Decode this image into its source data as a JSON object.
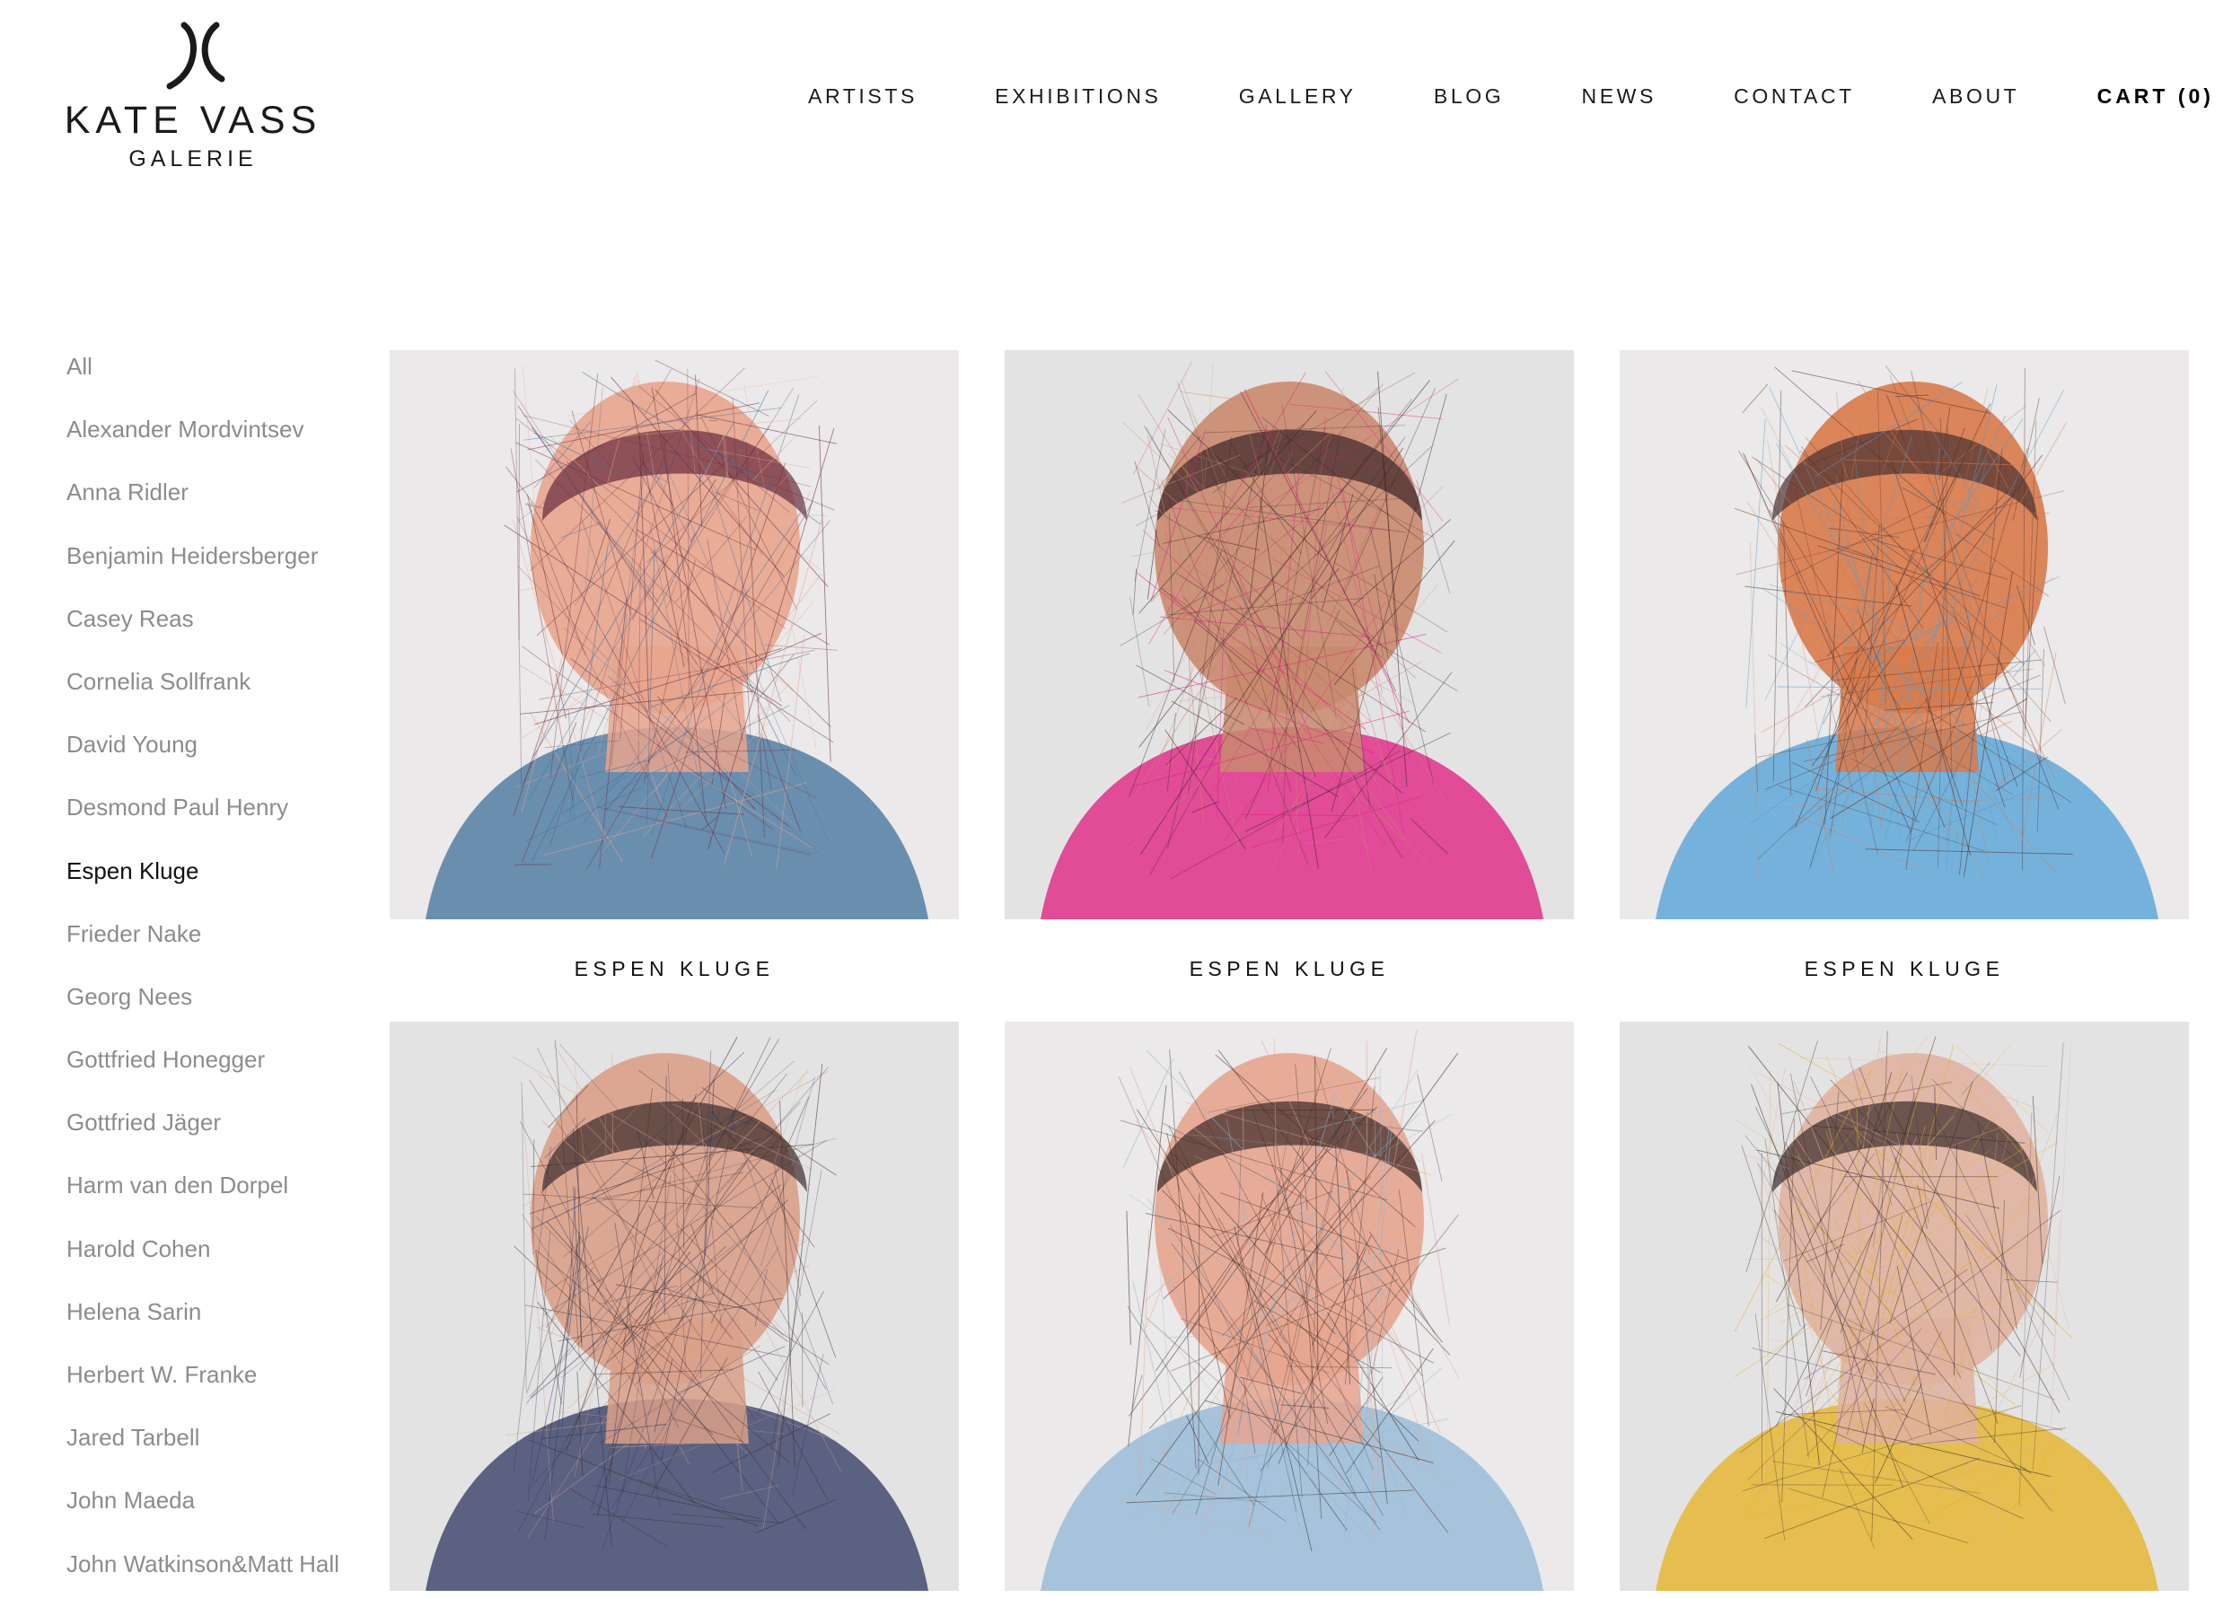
{
  "brand": {
    "name": "KATE VASS",
    "sub": "GALERIE"
  },
  "nav": {
    "items": [
      "ARTISTS",
      "EXHIBITIONS",
      "GALLERY",
      "BLOG",
      "NEWS",
      "CONTACT",
      "ABOUT"
    ],
    "cart_label": "CART (0)"
  },
  "sidebar": {
    "active": "Espen Kluge",
    "items": [
      "All",
      "Alexander Mordvintsev",
      "Anna Ridler",
      "Benjamin Heidersberger",
      "Casey Reas",
      "Cornelia Sollfrank",
      "David Young",
      "Desmond Paul Henry",
      "Espen Kluge",
      "Frieder Nake",
      "Georg Nees",
      "Gottfried Honegger",
      "Gottfried Jäger",
      "Harm van den Dorpel",
      "Harold Cohen",
      "Helena Sarin",
      "Herbert W. Franke",
      "Jared Tarbell",
      "John Maeda",
      "John Watkinson&Matt Hall"
    ]
  },
  "artworks": [
    {
      "artist": "ESPEN KLUGE",
      "image": "portrait-pink-blue-icon",
      "palette": [
        "#e8a58e",
        "#6a2b3d",
        "#3f6f9a"
      ]
    },
    {
      "artist": "ESPEN KLUGE",
      "image": "portrait-magenta-shirt-icon",
      "palette": [
        "#c98a6e",
        "#3a2328",
        "#e0187e"
      ]
    },
    {
      "artist": "ESPEN KLUGE",
      "image": "portrait-blue-collar-icon",
      "palette": [
        "#d97a4a",
        "#4a3030",
        "#4d9fd6"
      ]
    },
    {
      "artist": "",
      "image": "portrait-navy-shirt-icon",
      "palette": [
        "#d9a08a",
        "#3a2a2a",
        "#2d3560"
      ]
    },
    {
      "artist": "",
      "image": "portrait-pale-blue-icon",
      "palette": [
        "#e7a58f",
        "#3b2a28",
        "#8fb6d6"
      ]
    },
    {
      "artist": "",
      "image": "portrait-yellow-shirt-icon",
      "palette": [
        "#e0b2a0",
        "#3a2a2a",
        "#e5b11d"
      ]
    }
  ]
}
